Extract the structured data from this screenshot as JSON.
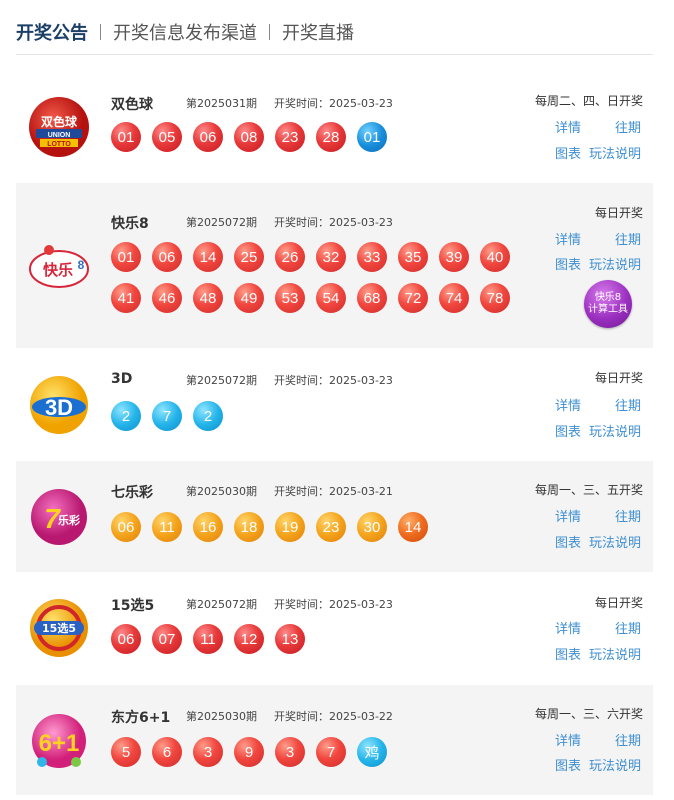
{
  "tabs": [
    {
      "label": "开奖公告",
      "active": true
    },
    {
      "label": "开奖信息发布渠道",
      "active": false
    },
    {
      "label": "开奖直播",
      "active": false
    }
  ],
  "links": {
    "detail": "详情",
    "history": "往期",
    "chart": "图表",
    "rules": "玩法说明"
  },
  "lotteries": [
    {
      "name": "双色球",
      "logo_text": "双色球 UNION LOTTO",
      "issue": "第2025031期",
      "time": "开奖时间：2025-03-23",
      "schedule": "每周二、四、日开奖",
      "balls": [
        "01",
        "05",
        "06",
        "08",
        "23",
        "28",
        "01"
      ]
    },
    {
      "name": "快乐8",
      "logo_text": "快乐8",
      "issue": "第2025072期",
      "time": "开奖时间：2025-03-23",
      "schedule": "每日开奖",
      "balls": [
        "01",
        "06",
        "14",
        "25",
        "26",
        "32",
        "33",
        "35",
        "39",
        "40",
        "41",
        "46",
        "48",
        "49",
        "53",
        "54",
        "68",
        "72",
        "74",
        "78"
      ],
      "tool": [
        "快乐8",
        "计算工具"
      ]
    },
    {
      "name": "3D",
      "logo_text": "3D",
      "issue": "第2025072期",
      "time": "开奖时间：2025-03-23",
      "schedule": "每日开奖",
      "balls": [
        "2",
        "7",
        "2"
      ]
    },
    {
      "name": "七乐彩",
      "logo_text": "7乐彩",
      "issue": "第2025030期",
      "time": "开奖时间：2025-03-21",
      "schedule": "每周一、三、五开奖",
      "balls": [
        "06",
        "11",
        "16",
        "18",
        "19",
        "23",
        "30",
        "14"
      ]
    },
    {
      "name": "15选5",
      "logo_text": "15选5",
      "issue": "第2025072期",
      "time": "开奖时间：2025-03-23",
      "schedule": "每日开奖",
      "balls": [
        "06",
        "07",
        "11",
        "12",
        "13"
      ]
    },
    {
      "name": "东方6+1",
      "logo_text": "6+1",
      "issue": "第2025030期",
      "time": "开奖时间：2025-03-22",
      "schedule": "每周一、三、六开奖",
      "balls": [
        "5",
        "6",
        "3",
        "9",
        "3",
        "7",
        "鸡"
      ]
    }
  ],
  "colors": {
    "red": "#d9262e",
    "blue": "#1a8fdc",
    "orange": "#f4a31b",
    "link": "#3f8fd2",
    "title": "#1b3f66"
  }
}
